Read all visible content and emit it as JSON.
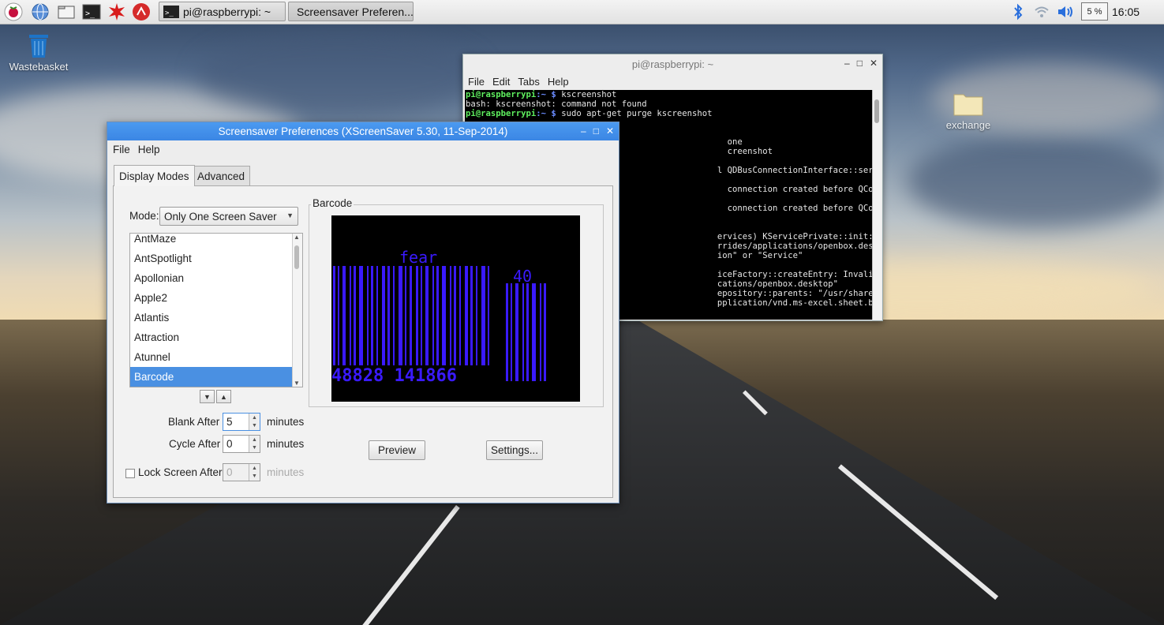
{
  "taskbar": {
    "windows": [
      {
        "label": "pi@raspberrypi: ~"
      },
      {
        "label": "Screensaver Preferen..."
      }
    ],
    "cpu_label": "5 %",
    "clock": "16:05"
  },
  "desktop": {
    "icons": [
      {
        "label": "Wastebasket"
      },
      {
        "label": "exchange"
      }
    ]
  },
  "terminal": {
    "title": "pi@raspberrypi: ~",
    "menu": [
      "File",
      "Edit",
      "Tabs",
      "Help"
    ],
    "lines": [
      {
        "prompt": "pi@raspberrypi",
        "path": ":~ $",
        "text": " kscreenshot"
      },
      {
        "text": "bash: kscreenshot: command not found"
      },
      {
        "prompt": "pi@raspberrypi",
        "path": ":~ $",
        "text": " sudo apt-get purge kscreenshot"
      },
      {
        "text": ""
      },
      {
        "text": ""
      },
      {
        "text": "                                                    one"
      },
      {
        "text": "                                                    creenshot"
      },
      {
        "text": ""
      },
      {
        "text": "                                                  l QDBusConnectionInterface::serviceOwnerChanged(QS"
      },
      {
        "text": ""
      },
      {
        "text": "                                                    connection created before QCoreApplication. Appli"
      },
      {
        "text": ""
      },
      {
        "text": "                                                    connection created before QCoreApplication. Appli"
      },
      {
        "text": ""
      },
      {
        "text": ""
      },
      {
        "text": "                                                  ervices) KServicePrivate::init: The desktop entry"
      },
      {
        "text": "                                                  rrides/applications/openbox.desktop\"  has Type= \"X"
      },
      {
        "text": "                                                  ion\" or \"Service\""
      },
      {
        "text": ""
      },
      {
        "text": "                                                  iceFactory::createEntry: Invalid Service :  \"/usr/"
      },
      {
        "text": "                                                  cations/openbox.desktop\""
      },
      {
        "text": "                                                  epository::parents: \"/usr/share/mime/subclasses\""
      },
      {
        "text": "                                                  pplication/vnd.ms-excel.sheet.binary.macroEnabled."
      }
    ]
  },
  "dialog": {
    "title": "Screensaver Preferences  (XScreenSaver 5.30, 11-Sep-2014)",
    "menu": [
      "File",
      "Help"
    ],
    "tabs": [
      "Display Modes",
      "Advanced"
    ],
    "mode_label": "Mode:",
    "mode_value": "Only One Screen Saver",
    "savers": [
      "AntMaze",
      "AntSpotlight",
      "Apollonian",
      "Apple2",
      "Atlantis",
      "Attraction",
      "Atunnel",
      "Barcode"
    ],
    "selected_saver": "Barcode",
    "preview_title": "Barcode",
    "preview_text": {
      "word": "fear",
      "num": "40",
      "digits": "48828 141866"
    },
    "blank_after_label": "Blank After",
    "blank_after_value": "5",
    "cycle_after_label": "Cycle After",
    "cycle_after_value": "0",
    "lock_label": "Lock Screen After",
    "lock_value": "0",
    "minutes": "minutes",
    "preview_button": "Preview",
    "settings_button": "Settings..."
  },
  "colors": {
    "title_bar": "#3b86e4",
    "selection": "#4a90e2",
    "barcode": "#3a1aff",
    "terminal_prompt": "#5ff05f"
  }
}
